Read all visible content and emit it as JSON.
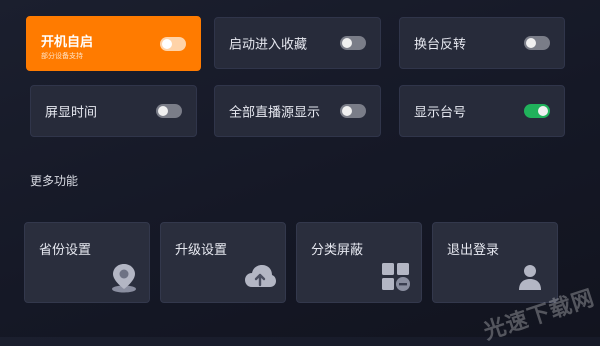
{
  "toggles": [
    {
      "label": "开机自启",
      "sublabel": "部分设备支持",
      "on": false,
      "highlighted": true
    },
    {
      "label": "启动进入收藏",
      "on": false
    },
    {
      "label": "换台反转",
      "on": false
    },
    {
      "label": "屏显时间",
      "on": false
    },
    {
      "label": "全部直播源显示",
      "on": false
    },
    {
      "label": "显示台号",
      "on": true
    }
  ],
  "section_title": "更多功能",
  "features": [
    {
      "label": "省份设置",
      "icon": "location-pin-icon"
    },
    {
      "label": "升级设置",
      "icon": "cloud-upload-icon"
    },
    {
      "label": "分类屏蔽",
      "icon": "grid-block-icon"
    },
    {
      "label": "退出登录",
      "icon": "user-logout-icon"
    }
  ],
  "watermark": "光速下载网",
  "colors": {
    "accent": "#ff7b00",
    "switch_on": "#20b25b",
    "card": "#272b3a",
    "background": "#151826"
  }
}
